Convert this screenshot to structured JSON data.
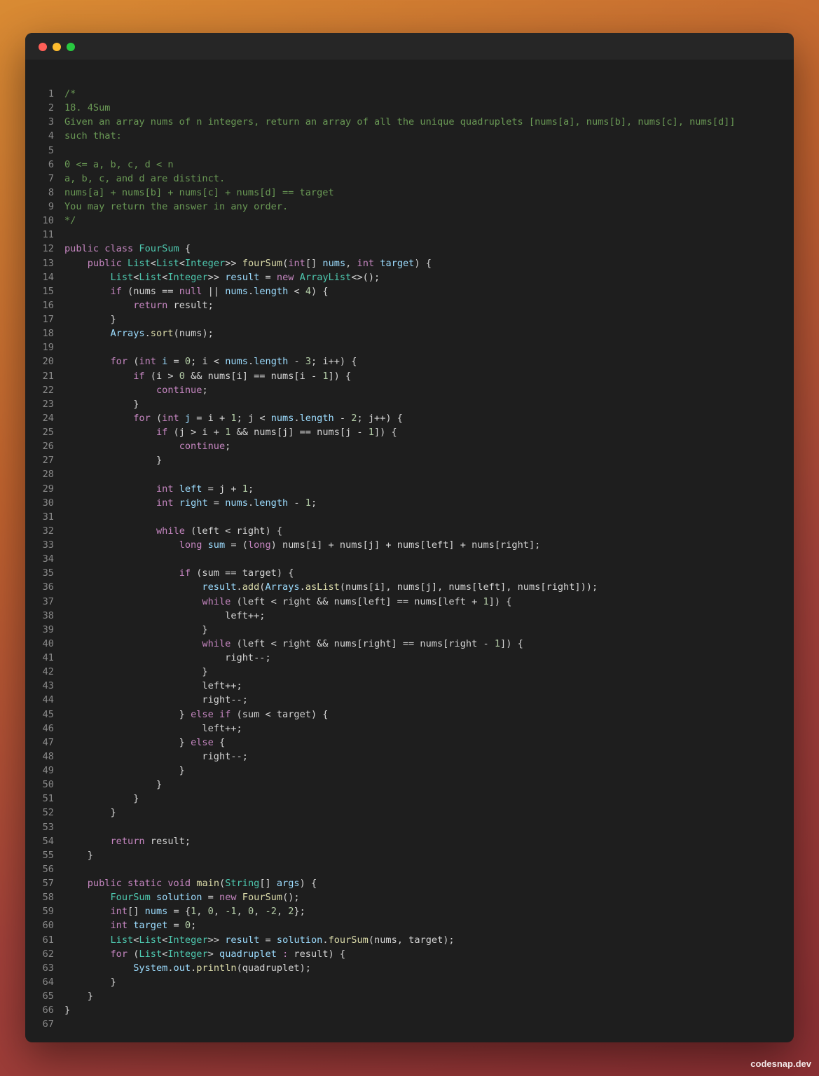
{
  "window": {
    "controls": [
      "close",
      "minimize",
      "maximize"
    ],
    "colors": {
      "close": "#ff5f57",
      "minimize": "#febc2e",
      "maximize": "#28c840"
    }
  },
  "editor": {
    "language": "java",
    "lines": [
      [
        [
          "c",
          "/*"
        ]
      ],
      [
        [
          "c",
          "18. 4Sum"
        ]
      ],
      [
        [
          "c",
          "Given an array nums of n integers, return an array of all the unique quadruplets [nums[a], nums[b], nums[c], nums[d]]"
        ]
      ],
      [
        [
          "c",
          "such that:"
        ]
      ],
      [],
      [
        [
          "c",
          "0 <= a, b, c, d < n"
        ]
      ],
      [
        [
          "c",
          "a, b, c, and d are distinct."
        ]
      ],
      [
        [
          "c",
          "nums[a] + nums[b] + nums[c] + nums[d] == target"
        ]
      ],
      [
        [
          "c",
          "You may return the answer in any order."
        ]
      ],
      [
        [
          "c",
          "*/"
        ]
      ],
      [],
      [
        [
          "k",
          "public "
        ],
        [
          "k",
          "class "
        ],
        [
          "t",
          "FourSum"
        ],
        [
          "p",
          " {"
        ]
      ],
      [
        [
          "p",
          "    "
        ],
        [
          "k",
          "public "
        ],
        [
          "t",
          "List"
        ],
        [
          "p",
          "<"
        ],
        [
          "t",
          "List"
        ],
        [
          "p",
          "<"
        ],
        [
          "t",
          "Integer"
        ],
        [
          "p",
          ">> "
        ],
        [
          "f",
          "fourSum"
        ],
        [
          "p",
          "("
        ],
        [
          "k",
          "int"
        ],
        [
          "p",
          "[] "
        ],
        [
          "v",
          "nums"
        ],
        [
          "p",
          ", "
        ],
        [
          "k",
          "int "
        ],
        [
          "v",
          "target"
        ],
        [
          "p",
          ") {"
        ]
      ],
      [
        [
          "p",
          "        "
        ],
        [
          "t",
          "List"
        ],
        [
          "p",
          "<"
        ],
        [
          "t",
          "List"
        ],
        [
          "p",
          "<"
        ],
        [
          "t",
          "Integer"
        ],
        [
          "p",
          ">> "
        ],
        [
          "v",
          "result"
        ],
        [
          "p",
          " = "
        ],
        [
          "k",
          "new "
        ],
        [
          "t",
          "ArrayList"
        ],
        [
          "p",
          "<>();"
        ]
      ],
      [
        [
          "p",
          "        "
        ],
        [
          "k",
          "if "
        ],
        [
          "p",
          "(nums == "
        ],
        [
          "k",
          "null"
        ],
        [
          "p",
          " || "
        ],
        [
          "v",
          "nums"
        ],
        [
          "p",
          "."
        ],
        [
          "v",
          "length"
        ],
        [
          "p",
          " < "
        ],
        [
          "n",
          "4"
        ],
        [
          "p",
          ") {"
        ]
      ],
      [
        [
          "p",
          "            "
        ],
        [
          "k",
          "return "
        ],
        [
          "p",
          "result;"
        ]
      ],
      [
        [
          "p",
          "        }"
        ]
      ],
      [
        [
          "p",
          "        "
        ],
        [
          "v",
          "Arrays"
        ],
        [
          "p",
          "."
        ],
        [
          "f",
          "sort"
        ],
        [
          "p",
          "(nums);"
        ]
      ],
      [],
      [
        [
          "p",
          "        "
        ],
        [
          "k",
          "for "
        ],
        [
          "p",
          "("
        ],
        [
          "k",
          "int "
        ],
        [
          "v",
          "i"
        ],
        [
          "p",
          " = "
        ],
        [
          "n",
          "0"
        ],
        [
          "p",
          "; i < "
        ],
        [
          "v",
          "nums"
        ],
        [
          "p",
          "."
        ],
        [
          "v",
          "length"
        ],
        [
          "p",
          " - "
        ],
        [
          "n",
          "3"
        ],
        [
          "p",
          "; i++) {"
        ]
      ],
      [
        [
          "p",
          "            "
        ],
        [
          "k",
          "if "
        ],
        [
          "p",
          "(i > "
        ],
        [
          "n",
          "0"
        ],
        [
          "p",
          " && nums[i] == nums[i - "
        ],
        [
          "n",
          "1"
        ],
        [
          "p",
          "]) {"
        ]
      ],
      [
        [
          "p",
          "                "
        ],
        [
          "k",
          "continue"
        ],
        [
          "p",
          ";"
        ]
      ],
      [
        [
          "p",
          "            }"
        ]
      ],
      [
        [
          "p",
          "            "
        ],
        [
          "k",
          "for "
        ],
        [
          "p",
          "("
        ],
        [
          "k",
          "int "
        ],
        [
          "v",
          "j"
        ],
        [
          "p",
          " = i + "
        ],
        [
          "n",
          "1"
        ],
        [
          "p",
          "; j < "
        ],
        [
          "v",
          "nums"
        ],
        [
          "p",
          "."
        ],
        [
          "v",
          "length"
        ],
        [
          "p",
          " - "
        ],
        [
          "n",
          "2"
        ],
        [
          "p",
          "; j++) {"
        ]
      ],
      [
        [
          "p",
          "                "
        ],
        [
          "k",
          "if "
        ],
        [
          "p",
          "(j > i + "
        ],
        [
          "n",
          "1"
        ],
        [
          "p",
          " && nums[j] == nums[j - "
        ],
        [
          "n",
          "1"
        ],
        [
          "p",
          "]) {"
        ]
      ],
      [
        [
          "p",
          "                    "
        ],
        [
          "k",
          "continue"
        ],
        [
          "p",
          ";"
        ]
      ],
      [
        [
          "p",
          "                }"
        ]
      ],
      [],
      [
        [
          "p",
          "                "
        ],
        [
          "k",
          "int "
        ],
        [
          "v",
          "left"
        ],
        [
          "p",
          " = j + "
        ],
        [
          "n",
          "1"
        ],
        [
          "p",
          ";"
        ]
      ],
      [
        [
          "p",
          "                "
        ],
        [
          "k",
          "int "
        ],
        [
          "v",
          "right"
        ],
        [
          "p",
          " = "
        ],
        [
          "v",
          "nums"
        ],
        [
          "p",
          "."
        ],
        [
          "v",
          "length"
        ],
        [
          "p",
          " - "
        ],
        [
          "n",
          "1"
        ],
        [
          "p",
          ";"
        ]
      ],
      [],
      [
        [
          "p",
          "                "
        ],
        [
          "k",
          "while "
        ],
        [
          "p",
          "(left < right) {"
        ]
      ],
      [
        [
          "p",
          "                    "
        ],
        [
          "k",
          "long "
        ],
        [
          "v",
          "sum"
        ],
        [
          "p",
          " = ("
        ],
        [
          "k",
          "long"
        ],
        [
          "p",
          ") nums[i] + nums[j] + nums[left] + nums[right];"
        ]
      ],
      [],
      [
        [
          "p",
          "                    "
        ],
        [
          "k",
          "if "
        ],
        [
          "p",
          "(sum == target) {"
        ]
      ],
      [
        [
          "p",
          "                        "
        ],
        [
          "v",
          "result"
        ],
        [
          "p",
          "."
        ],
        [
          "f",
          "add"
        ],
        [
          "p",
          "("
        ],
        [
          "v",
          "Arrays"
        ],
        [
          "p",
          "."
        ],
        [
          "f",
          "asList"
        ],
        [
          "p",
          "(nums[i], nums[j], nums[left], nums[right]));"
        ]
      ],
      [
        [
          "p",
          "                        "
        ],
        [
          "k",
          "while "
        ],
        [
          "p",
          "(left < right && nums[left] == nums[left + "
        ],
        [
          "n",
          "1"
        ],
        [
          "p",
          "]) {"
        ]
      ],
      [
        [
          "p",
          "                            left++;"
        ]
      ],
      [
        [
          "p",
          "                        }"
        ]
      ],
      [
        [
          "p",
          "                        "
        ],
        [
          "k",
          "while "
        ],
        [
          "p",
          "(left < right && nums[right] == nums[right - "
        ],
        [
          "n",
          "1"
        ],
        [
          "p",
          "]) {"
        ]
      ],
      [
        [
          "p",
          "                            right--;"
        ]
      ],
      [
        [
          "p",
          "                        }"
        ]
      ],
      [
        [
          "p",
          "                        left++;"
        ]
      ],
      [
        [
          "p",
          "                        right--;"
        ]
      ],
      [
        [
          "p",
          "                    } "
        ],
        [
          "k",
          "else if "
        ],
        [
          "p",
          "(sum < target) {"
        ]
      ],
      [
        [
          "p",
          "                        left++;"
        ]
      ],
      [
        [
          "p",
          "                    } "
        ],
        [
          "k",
          "else"
        ],
        [
          "p",
          " {"
        ]
      ],
      [
        [
          "p",
          "                        right--;"
        ]
      ],
      [
        [
          "p",
          "                    }"
        ]
      ],
      [
        [
          "p",
          "                }"
        ]
      ],
      [
        [
          "p",
          "            }"
        ]
      ],
      [
        [
          "p",
          "        }"
        ]
      ],
      [],
      [
        [
          "p",
          "        "
        ],
        [
          "k",
          "return "
        ],
        [
          "p",
          "result;"
        ]
      ],
      [
        [
          "p",
          "    }"
        ]
      ],
      [],
      [
        [
          "p",
          "    "
        ],
        [
          "k",
          "public "
        ],
        [
          "k",
          "static "
        ],
        [
          "k",
          "void "
        ],
        [
          "f",
          "main"
        ],
        [
          "p",
          "("
        ],
        [
          "t",
          "String"
        ],
        [
          "p",
          "[] "
        ],
        [
          "v",
          "args"
        ],
        [
          "p",
          ") {"
        ]
      ],
      [
        [
          "p",
          "        "
        ],
        [
          "t",
          "FourSum"
        ],
        [
          "p",
          " "
        ],
        [
          "v",
          "solution"
        ],
        [
          "p",
          " = "
        ],
        [
          "k",
          "new "
        ],
        [
          "f",
          "FourSum"
        ],
        [
          "p",
          "();"
        ]
      ],
      [
        [
          "p",
          "        "
        ],
        [
          "k",
          "int"
        ],
        [
          "p",
          "[] "
        ],
        [
          "v",
          "nums"
        ],
        [
          "p",
          " = {"
        ],
        [
          "n",
          "1"
        ],
        [
          "p",
          ", "
        ],
        [
          "n",
          "0"
        ],
        [
          "p",
          ", "
        ],
        [
          "n",
          "-1"
        ],
        [
          "p",
          ", "
        ],
        [
          "n",
          "0"
        ],
        [
          "p",
          ", "
        ],
        [
          "n",
          "-2"
        ],
        [
          "p",
          ", "
        ],
        [
          "n",
          "2"
        ],
        [
          "p",
          "};"
        ]
      ],
      [
        [
          "p",
          "        "
        ],
        [
          "k",
          "int "
        ],
        [
          "v",
          "target"
        ],
        [
          "p",
          " = "
        ],
        [
          "n",
          "0"
        ],
        [
          "p",
          ";"
        ]
      ],
      [
        [
          "p",
          "        "
        ],
        [
          "t",
          "List"
        ],
        [
          "p",
          "<"
        ],
        [
          "t",
          "List"
        ],
        [
          "p",
          "<"
        ],
        [
          "t",
          "Integer"
        ],
        [
          "p",
          ">> "
        ],
        [
          "v",
          "result"
        ],
        [
          "p",
          " = "
        ],
        [
          "v",
          "solution"
        ],
        [
          "p",
          "."
        ],
        [
          "f",
          "fourSum"
        ],
        [
          "p",
          "(nums, target);"
        ]
      ],
      [
        [
          "p",
          "        "
        ],
        [
          "k",
          "for "
        ],
        [
          "p",
          "("
        ],
        [
          "t",
          "List"
        ],
        [
          "p",
          "<"
        ],
        [
          "t",
          "Integer"
        ],
        [
          "p",
          "> "
        ],
        [
          "v",
          "quadruplet"
        ],
        [
          "p",
          " "
        ],
        [
          "k",
          ":"
        ],
        [
          "p",
          " result) {"
        ]
      ],
      [
        [
          "p",
          "            "
        ],
        [
          "v",
          "System"
        ],
        [
          "p",
          "."
        ],
        [
          "v",
          "out"
        ],
        [
          "p",
          "."
        ],
        [
          "f",
          "println"
        ],
        [
          "p",
          "(quadruplet);"
        ]
      ],
      [
        [
          "p",
          "        }"
        ]
      ],
      [
        [
          "p",
          "    }"
        ]
      ],
      [
        [
          "p",
          "}"
        ]
      ],
      []
    ]
  },
  "watermark": "codesnap.dev"
}
